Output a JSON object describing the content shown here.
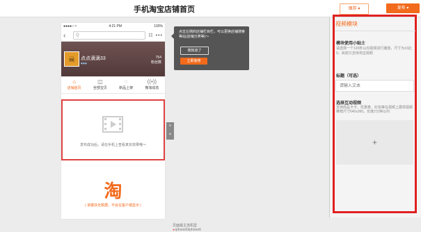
{
  "header": {
    "title": "手机淘宝店铺首页",
    "save_label": "保存 ▾",
    "publish_label": "发布 ▾"
  },
  "phone": {
    "status": {
      "signal": "●●●●○ ≈",
      "time": "4:21 PM",
      "battery": "100%"
    },
    "search_placeholder": "Q",
    "shop": {
      "name": "点点滴滴33",
      "hearts": "♥♥♥",
      "fans_count": "754",
      "fans_label": "粉丝数"
    },
    "tabs": [
      {
        "label": "店铺首页",
        "icon": "home-icon"
      },
      {
        "label": "全部宝贝",
        "icon": "bag-icon"
      },
      {
        "label": "新品上架",
        "icon": "chat-icon"
      },
      {
        "label": "微淘动态",
        "icon": "broadcast-icon"
      }
    ],
    "video_caption": "发布成功后，请在手机上查看真实效果哦～",
    "tao_glyph": "淘",
    "module_hint": "| 该模块无数据，不会在客户端显示 |"
  },
  "tooltip": {
    "text": "点击左侧的店铺栏目栏，可以更换店铺搜索等站(店铺分类等)～",
    "ok_label": "我知道了",
    "setup_label": "立即装修"
  },
  "side_controls": {
    "expand": "˅",
    "close": "×"
  },
  "bottom_note": {
    "line1": "页面最主流机型",
    "line2": "iphone5/iphone6"
  },
  "panel": {
    "title": "视频模块",
    "tips_title": "模块使用小贴士",
    "tips_text": "请选择一个120秒以内视频进行播放，尺寸为16比9，目前只支持淘宝视频",
    "title_label": "标题（可选）",
    "title_placeholder": "请输入文本",
    "video_label": "选择互动视频",
    "video_desc": "支持商品卡卡、优惠卷、红包等在视频上展现视频推荐尺寸640x360，长度2分钟以内",
    "upload_plus": "+"
  }
}
